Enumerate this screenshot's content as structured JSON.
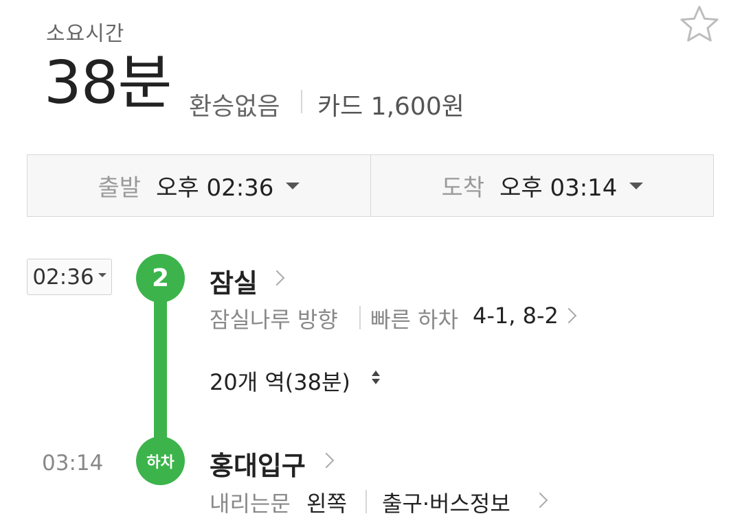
{
  "header": {
    "duration_label": "소요시간",
    "duration_value": "38분",
    "transfer": "환승없음",
    "fare": "카드 1,600원"
  },
  "time_selector": {
    "departure_label": "출발",
    "departure_value": "오후 02:36",
    "arrival_label": "도착",
    "arrival_value": "오후 03:14"
  },
  "route": {
    "line_number": "2",
    "line_color": "#3cb44b",
    "departure_time": "02:36",
    "departure_station": "잠실",
    "direction": "잠실나루 방향",
    "fast_alight_label": "빠른 하차",
    "fast_alight_value": "4-1, 8-2",
    "stations_count": "20개 역(38분)",
    "arrival_time": "03:14",
    "alight_badge": "하차",
    "arrival_station": "홍대입구",
    "door_label": "내리는문",
    "door_value": "왼쪽",
    "exit_info": "출구·버스정보"
  },
  "icons": {
    "favorite": "star-outline-icon",
    "dropdown": "caret-down-icon",
    "chevron": "chevron-right-icon",
    "expand": "expand-updown-icon"
  }
}
